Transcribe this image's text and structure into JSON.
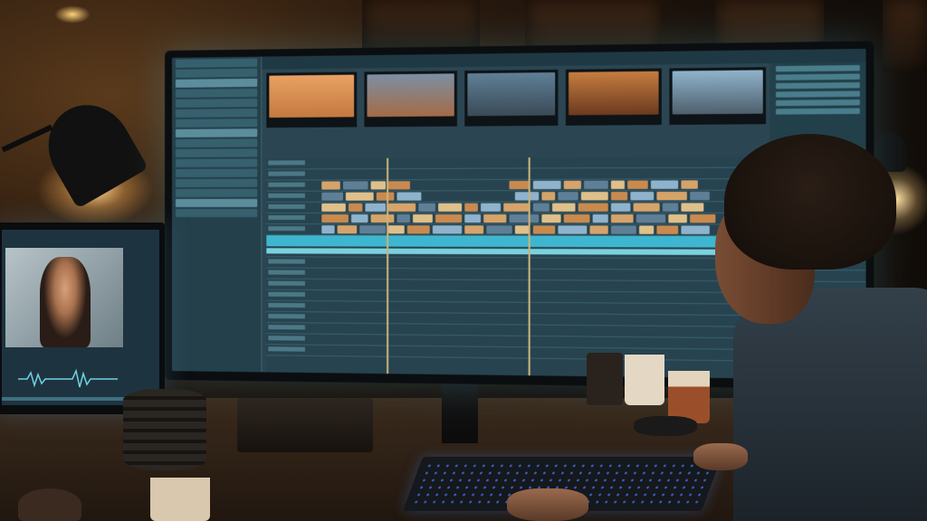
{
  "scene": {
    "description_free": true,
    "main_editor": {
      "thumbnails": [
        {
          "name": "thumb-desert",
          "colors": [
            "#e9a063",
            "#c47a3e"
          ],
          "label": "—"
        },
        {
          "name": "thumb-street",
          "colors": [
            "#7c8fa3",
            "#a46b46"
          ],
          "label": "—"
        },
        {
          "name": "thumb-crowd",
          "colors": [
            "#5f7f96",
            "#3a4a57"
          ],
          "label": "—"
        },
        {
          "name": "thumb-portrait",
          "colors": [
            "#c67c3f",
            "#6b3a1f"
          ],
          "label": "—"
        },
        {
          "name": "thumb-market",
          "colors": [
            "#8fb3cc",
            "#4e5f6c"
          ],
          "label": "—"
        }
      ],
      "accent": "#3fb6cf",
      "ui_bg": "#2b4652"
    },
    "side_monitor": {
      "screen_bg": "#1e3340",
      "waveform_color": "#6fd3e0"
    }
  }
}
